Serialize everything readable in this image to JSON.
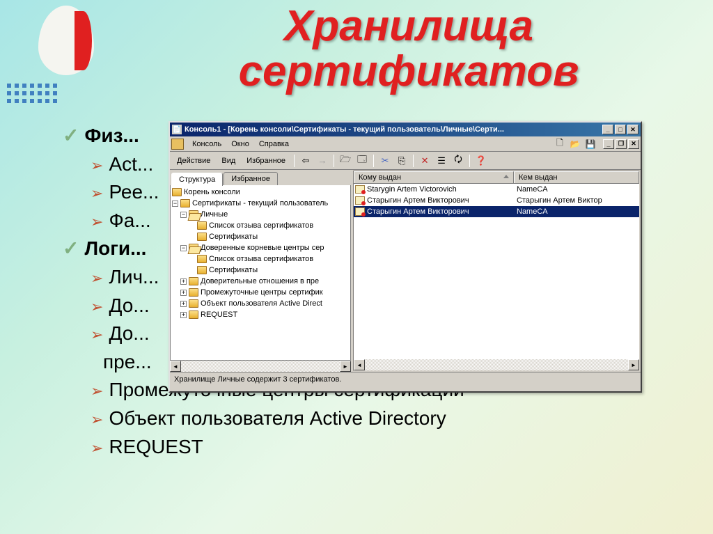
{
  "slide": {
    "title": "Хранилища сертификатов",
    "bullets": {
      "b1": "Физ...",
      "b1a": "Act...",
      "b1b": "Рее...",
      "b1c": "Фа...",
      "b2": "Логи...",
      "b2a": "Лич...",
      "b2b": "До...",
      "b2c": "До...",
      "b2c2": "пре...",
      "b2d": "Промежуточные центры сертификации",
      "b2e": "Объект пользователя Active Directory",
      "b2f": "REQUEST"
    }
  },
  "mmc": {
    "title": "Консоль1 - [Корень консоли\\Сертификаты - текущий пользователь\\Личные\\Серти...",
    "menu": {
      "console": "Консоль",
      "window": "Окно",
      "help": "Справка"
    },
    "toolbar": {
      "action": "Действие",
      "view": "Вид",
      "fav": "Избранное"
    },
    "tabs": {
      "structure": "Структура",
      "favorites": "Избранное"
    },
    "tree": {
      "root": "Корень консоли",
      "certs": "Сертификаты - текущий пользователь",
      "personal": "Личные",
      "crl": "Список отзыва сертификатов",
      "certificates": "Сертификаты",
      "trusted_root": "Доверенные корневые центры сер",
      "crl2": "Список отзыва сертификатов",
      "certificates2": "Сертификаты",
      "enterprise": "Доверительные отношения в пре",
      "intermediate": "Промежуточные центры сертифик",
      "ad_user": "Объект пользователя Active Direct",
      "request": "REQUEST"
    },
    "list": {
      "col_issued_to": "Кому выдан",
      "col_issued_by": "Кем выдан",
      "rows": [
        {
          "to": "Starygin Artem Victorovich",
          "by": "NameCA"
        },
        {
          "to": "Старыгин Артем Викторович",
          "by": "Старыгин Артем Виктор"
        },
        {
          "to": "Старыгин Артем Викторович",
          "by": "NameCA"
        }
      ]
    },
    "status": "Хранилище Личные содержит 3 сертификатов."
  }
}
